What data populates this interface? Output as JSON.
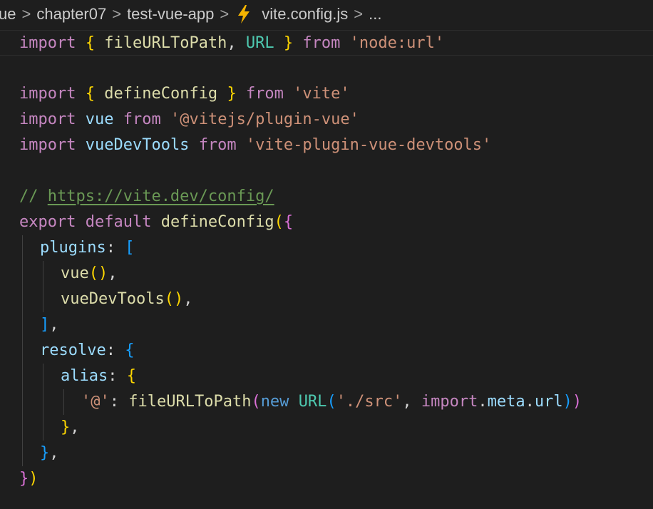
{
  "breadcrumb": {
    "items": [
      "ue",
      "chapter07",
      "test-vue-app",
      "vite.config.js",
      "..."
    ],
    "separator": ">",
    "file_icon": "vite-lightning-icon"
  },
  "colors": {
    "background": "#1e1e1e",
    "keyword": "#c586c0",
    "function": "#dcdcaa",
    "variable": "#9cdcfe",
    "string": "#ce9178",
    "class": "#4ec9b0",
    "storage": "#569cd6",
    "comment": "#6a9955",
    "bracket_level1": "#ffd700",
    "bracket_level2": "#da70d6",
    "bracket_level3": "#179fff",
    "vite_icon": "#f5b400"
  },
  "code": {
    "lines": [
      {
        "indent": 0,
        "tokens": [
          [
            "kw",
            "import"
          ],
          [
            "plain",
            " "
          ],
          [
            "b1",
            "{"
          ],
          [
            "plain",
            " "
          ],
          [
            "fn",
            "fileURLToPath"
          ],
          [
            "plain",
            ", "
          ],
          [
            "cls",
            "URL"
          ],
          [
            "plain",
            " "
          ],
          [
            "b1",
            "}"
          ],
          [
            "plain",
            " "
          ],
          [
            "kw",
            "from"
          ],
          [
            "plain",
            " "
          ],
          [
            "str",
            "'node:url'"
          ]
        ]
      },
      {
        "indent": 0,
        "tokens": []
      },
      {
        "indent": 0,
        "tokens": [
          [
            "kw",
            "import"
          ],
          [
            "plain",
            " "
          ],
          [
            "b1",
            "{"
          ],
          [
            "plain",
            " "
          ],
          [
            "fn",
            "defineConfig"
          ],
          [
            "plain",
            " "
          ],
          [
            "b1",
            "}"
          ],
          [
            "plain",
            " "
          ],
          [
            "kw",
            "from"
          ],
          [
            "plain",
            " "
          ],
          [
            "str",
            "'vite'"
          ]
        ]
      },
      {
        "indent": 0,
        "tokens": [
          [
            "kw",
            "import"
          ],
          [
            "plain",
            " "
          ],
          [
            "var",
            "vue"
          ],
          [
            "plain",
            " "
          ],
          [
            "kw",
            "from"
          ],
          [
            "plain",
            " "
          ],
          [
            "str",
            "'@vitejs/plugin-vue'"
          ]
        ]
      },
      {
        "indent": 0,
        "tokens": [
          [
            "kw",
            "import"
          ],
          [
            "plain",
            " "
          ],
          [
            "var",
            "vueDevTools"
          ],
          [
            "plain",
            " "
          ],
          [
            "kw",
            "from"
          ],
          [
            "plain",
            " "
          ],
          [
            "str",
            "'vite-plugin-vue-devtools'"
          ]
        ]
      },
      {
        "indent": 0,
        "tokens": []
      },
      {
        "indent": 0,
        "tokens": [
          [
            "cmt",
            "// "
          ],
          [
            "url",
            "https://vite.dev/config/"
          ]
        ]
      },
      {
        "indent": 0,
        "tokens": [
          [
            "kw",
            "export"
          ],
          [
            "plain",
            " "
          ],
          [
            "kw",
            "default"
          ],
          [
            "plain",
            " "
          ],
          [
            "fn",
            "defineConfig"
          ],
          [
            "b1",
            "("
          ],
          [
            "b2",
            "{"
          ]
        ]
      },
      {
        "indent": 1,
        "tokens": [
          [
            "var",
            "plugins"
          ],
          [
            "plain",
            ": "
          ],
          [
            "b3",
            "["
          ]
        ]
      },
      {
        "indent": 2,
        "tokens": [
          [
            "fn",
            "vue"
          ],
          [
            "b1",
            "()"
          ],
          [
            "plain",
            ","
          ]
        ]
      },
      {
        "indent": 2,
        "tokens": [
          [
            "fn",
            "vueDevTools"
          ],
          [
            "b1",
            "()"
          ],
          [
            "plain",
            ","
          ]
        ]
      },
      {
        "indent": 1,
        "tokens": [
          [
            "b3",
            "]"
          ],
          [
            "plain",
            ","
          ]
        ]
      },
      {
        "indent": 1,
        "tokens": [
          [
            "var",
            "resolve"
          ],
          [
            "plain",
            ": "
          ],
          [
            "b3",
            "{"
          ]
        ]
      },
      {
        "indent": 2,
        "tokens": [
          [
            "var",
            "alias"
          ],
          [
            "plain",
            ": "
          ],
          [
            "b1",
            "{"
          ]
        ]
      },
      {
        "indent": 3,
        "tokens": [
          [
            "str",
            "'@'"
          ],
          [
            "plain",
            ": "
          ],
          [
            "fn",
            "fileURLToPath"
          ],
          [
            "b2",
            "("
          ],
          [
            "kw2",
            "new"
          ],
          [
            "plain",
            " "
          ],
          [
            "cls",
            "URL"
          ],
          [
            "b3",
            "("
          ],
          [
            "str",
            "'./src'"
          ],
          [
            "plain",
            ", "
          ],
          [
            "kw",
            "import"
          ],
          [
            "plain",
            "."
          ],
          [
            "var",
            "meta"
          ],
          [
            "plain",
            "."
          ],
          [
            "var",
            "url"
          ],
          [
            "b3",
            ")"
          ],
          [
            "b2",
            ")"
          ]
        ]
      },
      {
        "indent": 2,
        "tokens": [
          [
            "b1",
            "}"
          ],
          [
            "plain",
            ","
          ]
        ]
      },
      {
        "indent": 1,
        "tokens": [
          [
            "b3",
            "}"
          ],
          [
            "plain",
            ","
          ]
        ]
      },
      {
        "indent": 0,
        "tokens": [
          [
            "b2",
            "}"
          ],
          [
            "b1",
            ")"
          ]
        ]
      }
    ]
  }
}
